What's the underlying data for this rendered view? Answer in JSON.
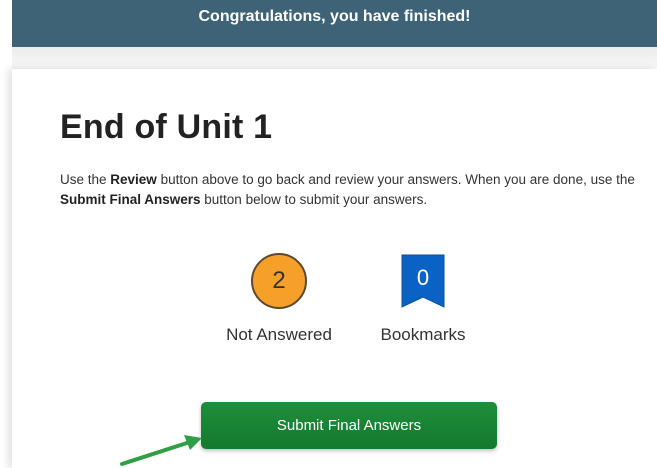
{
  "banner": {
    "text": "Congratulations, you have finished!"
  },
  "main": {
    "title": "End of Unit 1",
    "instructions": {
      "part1": "Use the ",
      "review": "Review",
      "part2": " button above to go back and review your answers. When you are done, use the ",
      "submit": "Submit Final Answers",
      "part3": " button below to submit your answers."
    }
  },
  "stats": {
    "not_answered": {
      "count": "2",
      "label": "Not Answered"
    },
    "bookmarks": {
      "count": "0",
      "label": "Bookmarks"
    }
  },
  "actions": {
    "submit_label": "Submit Final Answers"
  },
  "colors": {
    "banner": "#3e6377",
    "not_answered_badge": "#f6a02a",
    "bookmark_badge": "#0a62c5",
    "submit_button": "#1a8436",
    "annotation_arrow": "#2f9e44"
  },
  "icons": {
    "not_answered": "orange-circle-badge",
    "bookmarks": "bookmark-icon",
    "annotation": "green-arrow-icon"
  }
}
